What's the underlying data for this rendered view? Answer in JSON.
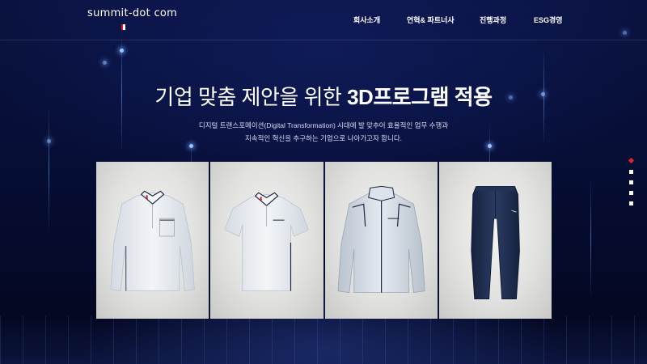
{
  "header": {
    "logo_text": "summit-dot com",
    "nav": [
      {
        "label": "회사소개"
      },
      {
        "label": "연혁& 파트너사"
      },
      {
        "label": "진행과정"
      },
      {
        "label": "ESG경영"
      }
    ]
  },
  "hero": {
    "title_regular": "기업 맞춤 제안을 위한 ",
    "title_bold": "3D프로그램 적용",
    "desc_line1": "디지털 트랜스포메이션(Digital Transformation) 시대에 발 맞추어 효율적인 업무 수행과",
    "desc_line2": "지속적인 혁신을 추구하는 기업으로 나아가고자 합니다."
  },
  "products": [
    {
      "name": "long-sleeve-polo",
      "color": "#e8ecf1"
    },
    {
      "name": "short-sleeve-polo",
      "color": "#e9edf2"
    },
    {
      "name": "track-jacket",
      "color": "#d6dde5"
    },
    {
      "name": "navy-pants",
      "color": "#1f2f52"
    }
  ],
  "pager": {
    "count": 5,
    "active_index": 0
  },
  "colors": {
    "accent": "#e8202e",
    "background": "#070f38"
  }
}
